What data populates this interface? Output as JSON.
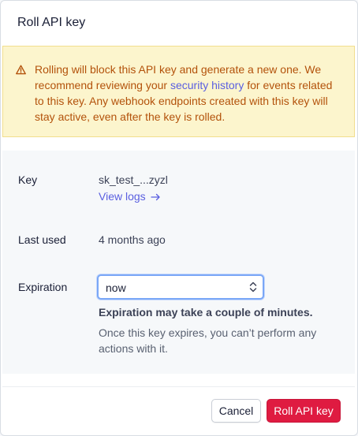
{
  "modal": {
    "title": "Roll API key"
  },
  "alert": {
    "icon": "warning-triangle-icon",
    "text_before": "Rolling will block this API key and generate a new one. We recommend reviewing your ",
    "link": "security history",
    "text_after": " for events related to this key. Any webhook endpoints created with this key will stay active, even after the key is rolled.",
    "color": "#b3520b",
    "background": "#fcf5cd"
  },
  "details": {
    "key_label": "Key",
    "key_value": "sk_test_...zyzl",
    "view_logs": "View logs",
    "view_logs_icon": "arrow-right-icon",
    "last_used_label": "Last used",
    "last_used_value": "4 months ago",
    "expiration_label": "Expiration",
    "expiration_selected": "now",
    "expiration_hint_bold": "Expiration may take a couple of minutes.",
    "expiration_hint": "Once this key expires, you can’t perform any actions with it."
  },
  "footer": {
    "cancel_label": "Cancel",
    "roll_label": "Roll API key",
    "roll_color": "#df1b41"
  }
}
